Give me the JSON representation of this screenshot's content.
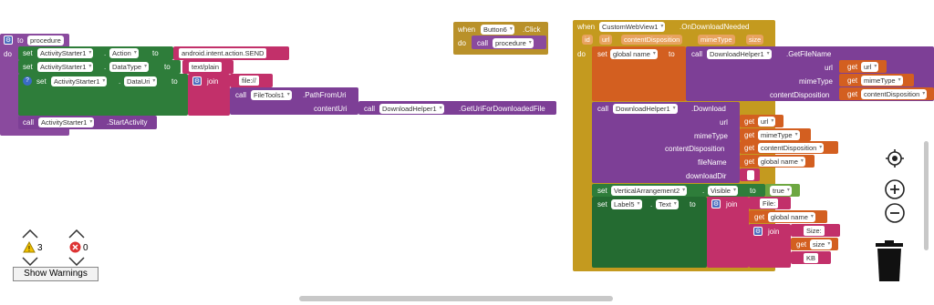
{
  "procedure_block": {
    "keyword_to": "to",
    "name": "procedure",
    "do": "do",
    "set": "set",
    "dot": ".",
    "to": "to",
    "activity_starter": "ActivityStarter1",
    "action_prop": "Action",
    "action_value": "android.intent.action.SEND",
    "datatype_prop": "DataType",
    "datatype_value": "text/plain",
    "datauri_prop": "DataUri",
    "join": "join",
    "file_prefix": "file://",
    "call": "call",
    "filetools": "FileTools1",
    "path_from_uri": ".PathFromUri",
    "content_uri": "contentUri",
    "download_helper": "DownloadHelper1",
    "get_uri_method": ".GetUriForDownloadedFile",
    "start_activity": ".StartActivity",
    "question_mark": "?"
  },
  "click_block": {
    "when": "when",
    "component": "Button6",
    "event": ".Click",
    "do": "do",
    "call": "call",
    "procedure": "procedure"
  },
  "download_block": {
    "when": "when",
    "component": "CustomWebView1",
    "event": ".OnDownloadNeeded",
    "params": [
      "id",
      "url",
      "contentDisposition",
      "mimeType",
      "size"
    ],
    "do": "do",
    "set": "set",
    "global_name": "global name",
    "to": "to",
    "call": "call",
    "helper": "DownloadHelper1",
    "get_file_name": ".GetFileName",
    "arg_url": "url",
    "arg_mime": "mimeType",
    "arg_cd": "contentDisposition",
    "get": "get",
    "download": ".Download",
    "arg_filename": "fileName",
    "arg_downloaddir": "downloadDir",
    "get_global_name": "global name",
    "download_dir_value": "",
    "vertical_arrangement": "VerticalArrangement2",
    "visible_prop": "Visible",
    "true_value": "true",
    "label": "Label5",
    "text_prop": "Text",
    "join": "join",
    "file_label": "File: ",
    "size_label": "Size: ",
    "size": "size",
    "kb": "KB"
  },
  "warnings": {
    "warning_count": "3",
    "error_count": "0",
    "show_warnings_label": "Show Warnings"
  },
  "icons": [
    "gear-icon",
    "warning-icon",
    "error-icon",
    "target-icon",
    "zoom-in-icon",
    "zoom-out-icon",
    "trash-icon"
  ]
}
